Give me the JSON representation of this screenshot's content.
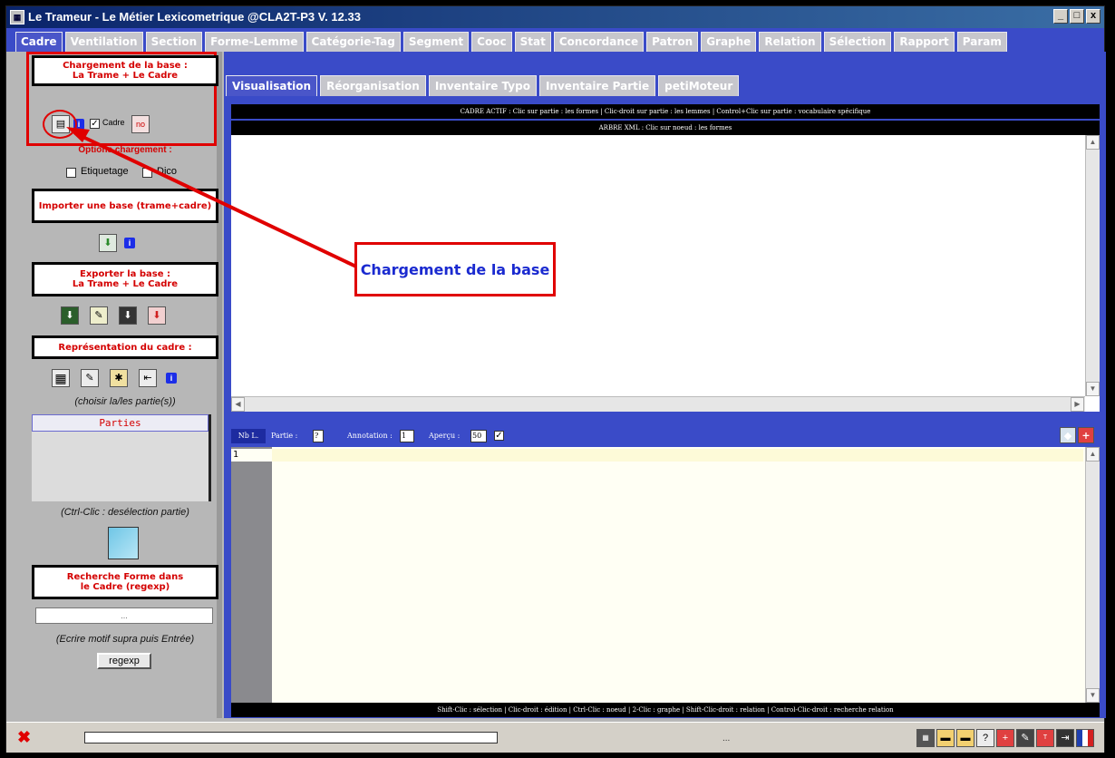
{
  "window": {
    "title": "Le Trameur - Le Métier Lexicometrique @CLA2T-P3 V. 12.33",
    "buttons": [
      "_",
      "□",
      "x"
    ]
  },
  "main_tabs": [
    {
      "label": "Cadre"
    },
    {
      "label": "Ventilation"
    },
    {
      "label": "Section"
    },
    {
      "label": "Forme-Lemme"
    },
    {
      "label": "Catégorie-Tag"
    },
    {
      "label": "Segment"
    },
    {
      "label": "Cooc"
    },
    {
      "label": "Stat"
    },
    {
      "label": "Concordance"
    },
    {
      "label": "Patron"
    },
    {
      "label": "Graphe"
    },
    {
      "label": "Relation"
    },
    {
      "label": "Sélection"
    },
    {
      "label": "Rapport"
    },
    {
      "label": "Param"
    }
  ],
  "sidebar": {
    "load_title_1": "Chargement de la base :",
    "load_title_2": "La Trame + Le Cadre",
    "cadre_checkbox_label": "Cadre",
    "options_title": "Options chargement :",
    "etiquetage_label": "Etiquetage",
    "dico_label": "Dico",
    "import_title": "Importer une base (trame+cadre)",
    "export_title_1": "Exporter la base :",
    "export_title_2": "La Trame + Le Cadre",
    "representation_title": "Représentation du cadre :",
    "choose_hint": "(choisir la/les partie(s))",
    "parties_header": "Parties",
    "deselect_hint": "(Ctrl-Clic : desélection partie)",
    "search_title_1": "Recherche Forme dans",
    "search_title_2": "le Cadre (regexp)",
    "search_value": "...",
    "search_hint": "(Ecrire motif supra puis Entrée)",
    "regexp_button": "regexp"
  },
  "sub_tabs": [
    {
      "label": "Visualisation"
    },
    {
      "label": "Réorganisation"
    },
    {
      "label": "Inventaire Typo"
    },
    {
      "label": "Inventaire Partie"
    },
    {
      "label": "petiMoteur"
    }
  ],
  "content": {
    "active_frame_info": "CADRE ACTIF : Clic sur partie : les formes | Clic-droit sur partie : les lemmes | Control+Clic sur partie : vocabulaire spécifique",
    "xml_tree_info": "ARBRE XML : Clic sur noeud : les formes",
    "bottom": {
      "nbl_label": "Nb L.",
      "partie_label": "Partie :",
      "partie_value": "?",
      "annotation_label": "Annotation :",
      "annotation_value": "1",
      "apercu_label": "Aperçu :",
      "apercu_value": "50"
    },
    "editor_line_number": "1",
    "footer_help": "Shift-Clic : sélection | Clic-droit : édition | Ctrl-Clic : noeud | 2-Clic : graphe | Shift-Clic-droit : relation | Control-Clic-droit : recherche relation"
  },
  "status": {
    "text": "..."
  },
  "annotation": {
    "label": "Chargement de la base"
  },
  "colors": {
    "accent_blue": "#3a4bc8",
    "annotation_red": "#e00000",
    "section_title_red": "#d40000"
  }
}
